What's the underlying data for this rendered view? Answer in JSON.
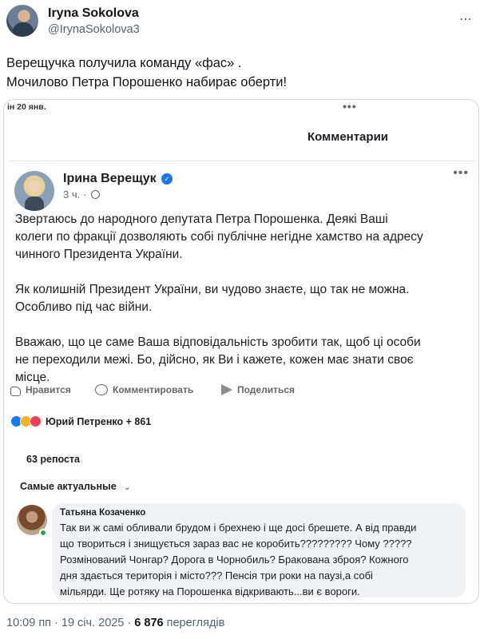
{
  "tweet": {
    "author_name": "Iryna Sokolova",
    "author_handle": "@IrynaSokolova3",
    "more_icon": "⋯",
    "text_lines": [
      "Верещучка получила команду «фас» .",
      "Мочилово Петра Порошенко набирає оберти!"
    ]
  },
  "embedded": {
    "date": "ін 20 янв.",
    "top_more_icon": "•••",
    "comments_title": "Комментарии",
    "post": {
      "author_name": "Ірина Верещук",
      "verified_icon": "✓",
      "time": "3 ч. ·",
      "more_icon": "•••",
      "paragraphs": [
        [
          "Звертаюсь до народного депутата Петра Порошенка. Деякі Ваші",
          "колеги по фракції дозволяють собі публічне негідне хамство на адресу",
          "чинного Президента України."
        ],
        [
          "Як колишній Президент України, ви чудово знаєте, що так не можна.",
          "Особливо під час війни."
        ],
        [
          "Вважаю, що це саме Ваша відповідальність зробити так, щоб ці особи",
          "не переходили межі. Бо, дійсно, як Ви і кажете, кожен має знати своє",
          "місце."
        ]
      ]
    },
    "actions": {
      "like": "Нравится",
      "comment": "Комментировать",
      "share": "Поделиться"
    },
    "reactions_summary": "Юрий Петренко + 861",
    "reposts": "63 репоста",
    "sort_label": "Самые актуальные",
    "sort_chevron": "⌄",
    "comment": {
      "author": "Татьяна Козаченко",
      "lines": [
        "Так ви ж самі обливали брудом і брехнею і ще досі брешете. А від правди",
        "що твориться і знищується зараз вас не коробить????????? Чому  ?????",
        "Розмінований Чонгар? Дорога в Чорнобиль? Бракована зброя?  Кожного",
        "дня здається  територія і місто??? Пенсія три роки на паузі,а собі",
        "мільярди. Ще ротяку на Порошенка відкривають...ви є вороги."
      ]
    }
  },
  "footer": {
    "time": "10:09 пп · 19 січ. 2025 · ",
    "views_count": "6 876",
    "views_label": " переглядів"
  },
  "colors": {
    "fb_blue": "#1877f2",
    "muted": "#536471",
    "bubble_bg": "#f0f2f5"
  }
}
